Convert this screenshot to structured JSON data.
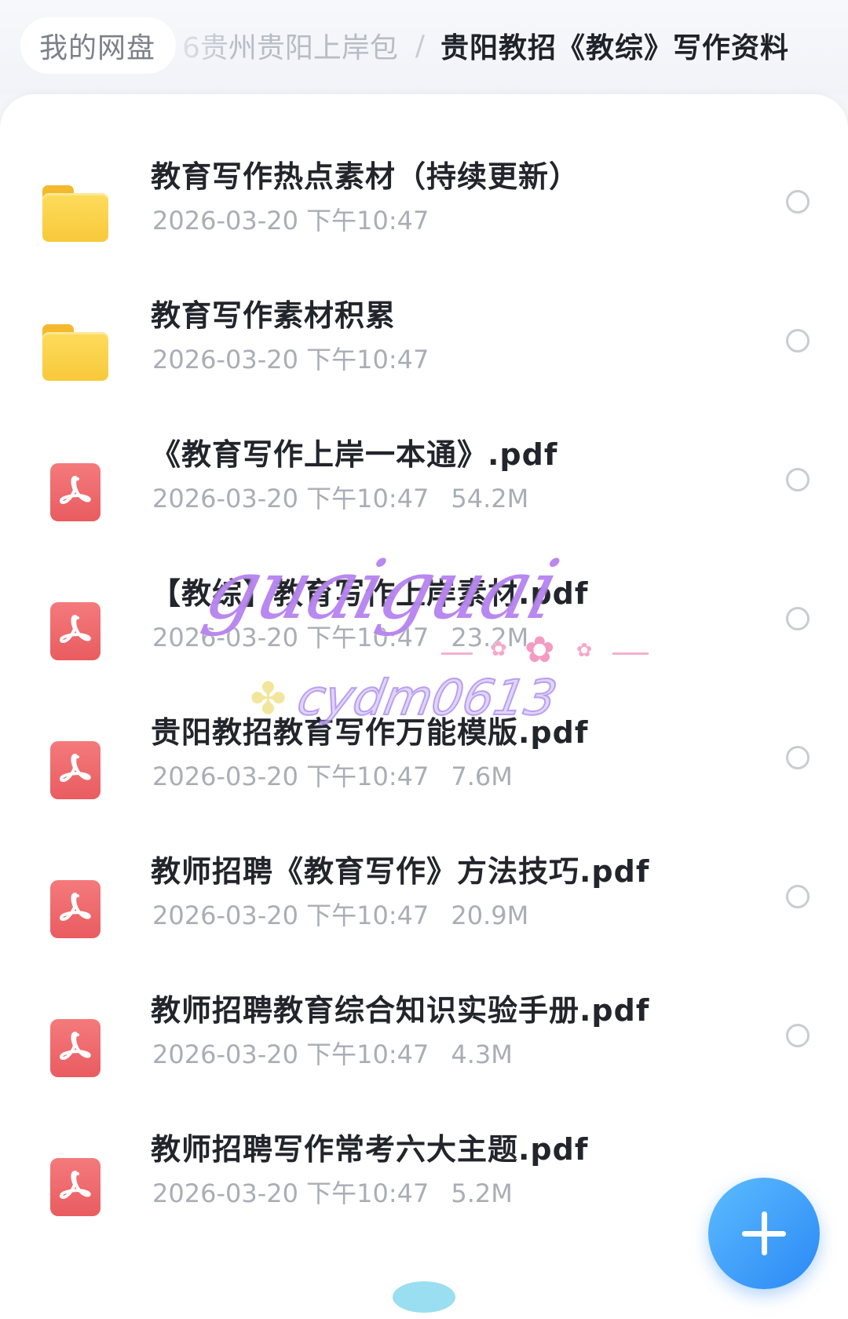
{
  "breadcrumb": {
    "root": "我的网盘",
    "parent": "6贵州贵阳上岸包",
    "separator": "/",
    "current": "贵阳教招《教综》写作资料"
  },
  "files": [
    {
      "name": "教育写作热点素材（持续更新）",
      "date": "2026-03-20 下午10:47",
      "size": "",
      "type": "folder",
      "icon": "folder-icon"
    },
    {
      "name": "教育写作素材积累",
      "date": "2026-03-20 下午10:47",
      "size": "",
      "type": "folder",
      "icon": "folder-icon"
    },
    {
      "name": "《教育写作上岸一本通》.pdf",
      "date": "2026-03-20 下午10:47",
      "size": "54.2M",
      "type": "pdf",
      "icon": "pdf-icon"
    },
    {
      "name": "【教综】教育写作上岸素材.pdf",
      "date": "2026-03-20 下午10:47",
      "size": "23.2M",
      "type": "pdf",
      "icon": "pdf-icon"
    },
    {
      "name": "贵阳教招教育写作万能模版.pdf",
      "date": "2026-03-20 下午10:47",
      "size": "7.6M",
      "type": "pdf",
      "icon": "pdf-icon"
    },
    {
      "name": "教师招聘《教育写作》方法技巧.pdf",
      "date": "2026-03-20 下午10:47",
      "size": "20.9M",
      "type": "pdf",
      "icon": "pdf-icon"
    },
    {
      "name": "教师招聘教育综合知识实验手册.pdf",
      "date": "2026-03-20 下午10:47",
      "size": "4.3M",
      "type": "pdf",
      "icon": "pdf-icon"
    },
    {
      "name": "教师招聘写作常考六大主题.pdf",
      "date": "2026-03-20 下午10:47",
      "size": "5.2M",
      "type": "pdf",
      "icon": "pdf-icon"
    }
  ],
  "fab": {
    "icon": "plus-icon"
  },
  "watermark": {
    "script": "guaiguai",
    "handle": "cydm0613"
  },
  "colors": {
    "accent": "#2b88f5",
    "folder": "#fcd34d",
    "pdf": "#ee6b6e",
    "meta_text": "#a9aeb6",
    "title_text": "#22252b"
  }
}
